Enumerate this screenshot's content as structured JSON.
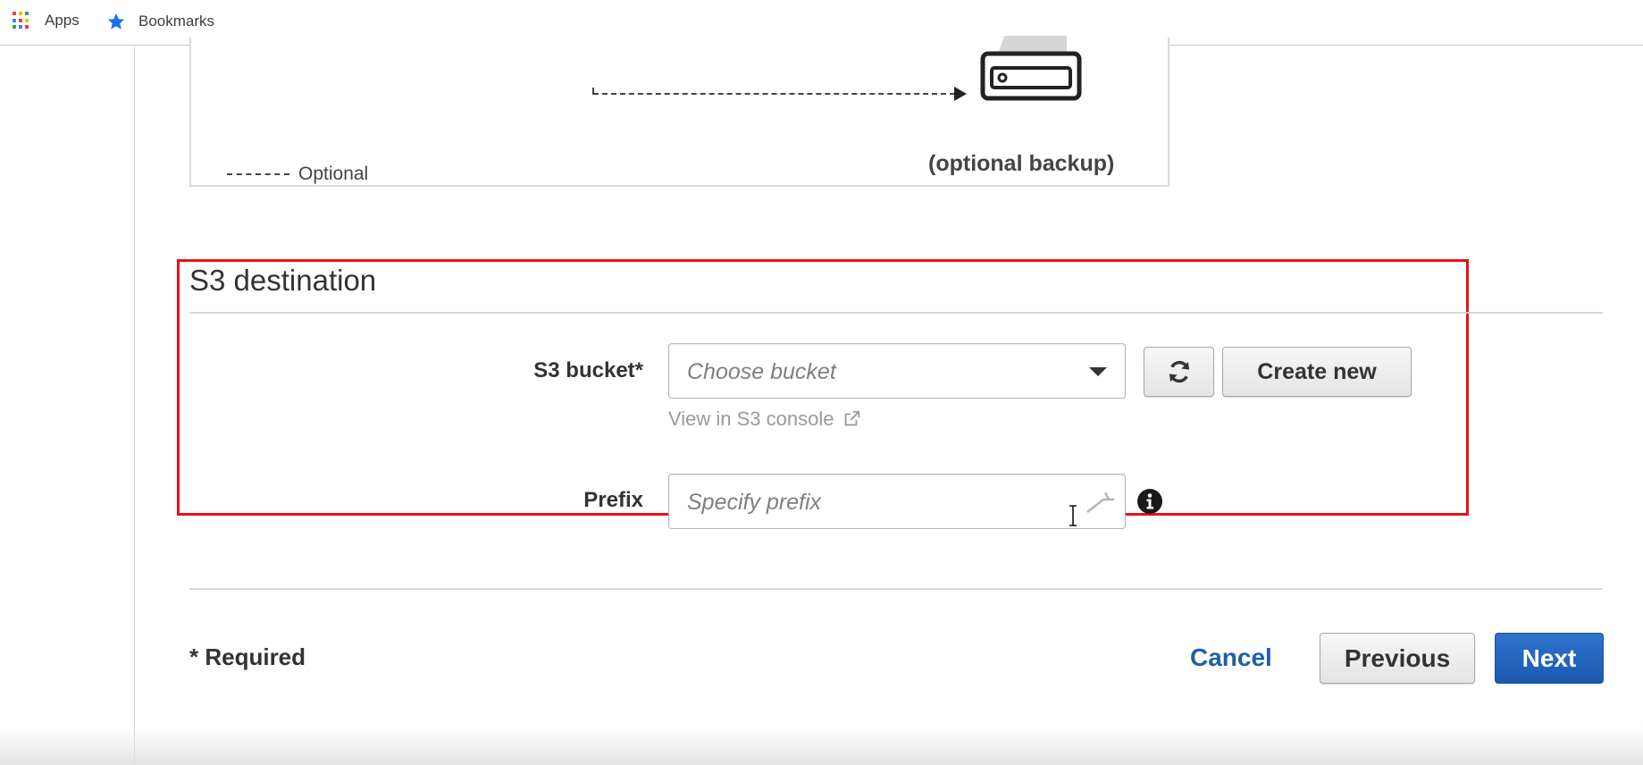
{
  "bookmarks_bar": {
    "apps_label": "Apps",
    "bookmarks_label": "Bookmarks"
  },
  "diagram": {
    "legend_label": "Optional",
    "backup_label": "(optional backup)"
  },
  "s3_destination": {
    "title": "S3 destination",
    "bucket_label": "S3 bucket*",
    "bucket_placeholder": "Choose bucket",
    "create_new_label": "Create new",
    "view_console_label": "View in S3 console",
    "prefix_label": "Prefix",
    "prefix_placeholder": "Specify prefix"
  },
  "footer": {
    "required_note": "* Required",
    "cancel_label": "Cancel",
    "previous_label": "Previous",
    "next_label": "Next"
  },
  "colors": {
    "highlight": "#e8111b",
    "primary": "#1b59b1",
    "link": "#1f5fa8"
  },
  "icons": {
    "apps": "apps-grid-icon",
    "bookmarks": "star-icon",
    "refresh": "refresh-icon",
    "dropdown": "chevron-down-icon",
    "external_link": "external-link-icon",
    "info": "info-icon",
    "disk": "hard-drive-icon",
    "cursor": "text-cursor-icon"
  }
}
